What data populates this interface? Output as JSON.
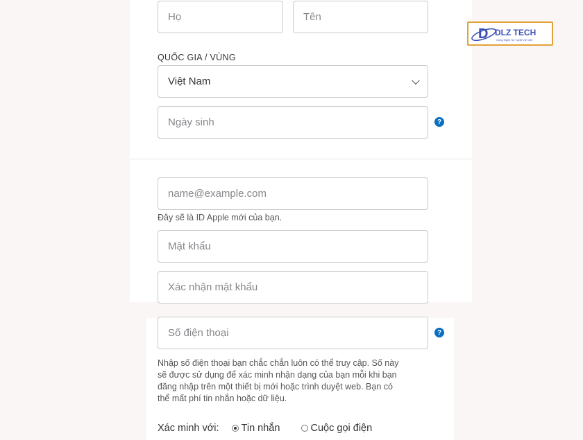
{
  "form": {
    "last_name_placeholder": "Họ",
    "first_name_placeholder": "Tên",
    "country_label": "QUỐC GIA / VÙNG",
    "country_value": "Việt Nam",
    "birthday_placeholder": "Ngày sinh",
    "email_placeholder": "name@example.com",
    "email_hint": "Đây sẽ là ID Apple mới của bạn.",
    "password_placeholder": "Mật khẩu",
    "confirm_password_placeholder": "Xác nhận mật khẩu",
    "phone_placeholder": "Số điện thoại",
    "phone_hint_lines": [
      "Nhập số điện thoại bạn chắc chắn luôn có thể truy cập. Số này",
      "sẽ được sử dụng để xác minh nhận dạng của bạn mỗi khi bạn",
      "đăng nhập trên một thiết bị mới hoặc trình duyệt web. Bạn có",
      "thể mất phí tin nhắn hoặc dữ liệu."
    ],
    "verify_label": "Xác minh với:",
    "verify_options": [
      {
        "label": "Tin nhắn",
        "checked": true
      },
      {
        "label": "Cuộc gọi điện",
        "checked": false
      }
    ],
    "help_symbol": "?"
  },
  "logo": {
    "text": "DLZ TECH",
    "letter": "D",
    "tagline": "Công Nghệ Số Tuyệt Vời Việt",
    "colors": {
      "primary": "#3a4fb8",
      "border": "#e2a23a",
      "accent": "#f2c200"
    }
  }
}
